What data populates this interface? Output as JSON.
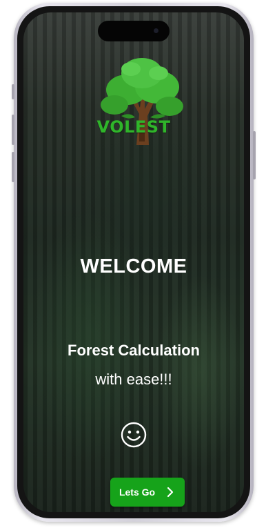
{
  "app": {
    "brand": "VOLEST",
    "logo_icon": "tree-logo-icon"
  },
  "screen": {
    "welcome": "WELCOME",
    "tagline_line1": "Forest Calculation",
    "tagline_line2": "with ease!!!",
    "emoji_icon": "smiley-face-icon"
  },
  "cta": {
    "label": "Lets Go",
    "icon": "chevron-right-icon"
  },
  "colors": {
    "brand_green": "#2fb52a",
    "button_green": "#16a31a",
    "text": "#ffffff"
  }
}
